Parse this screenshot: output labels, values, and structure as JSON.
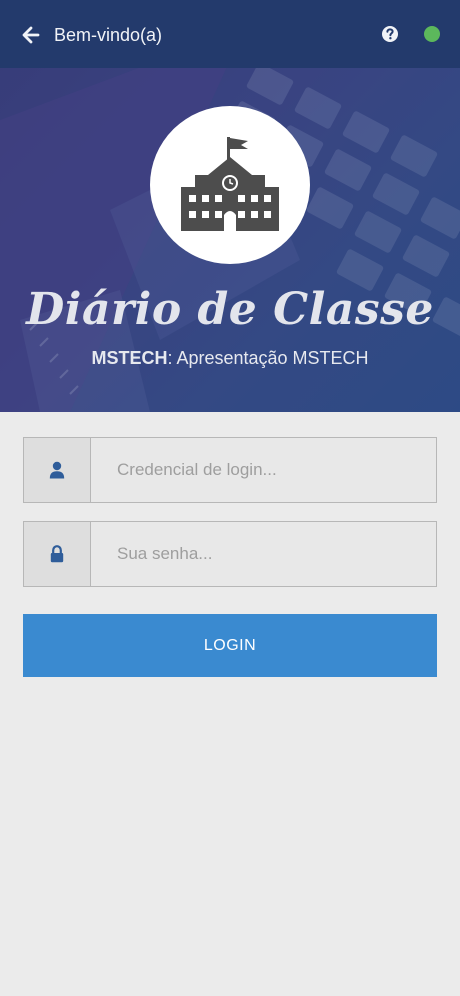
{
  "header": {
    "title": "Bem-vindo(a)",
    "status_color": "#5cb85c",
    "icons": {
      "back": "arrow-left-icon",
      "help": "question-circle-icon"
    }
  },
  "banner": {
    "logo_icon": "school-building-icon",
    "app_title": "Diário de Classe",
    "org_name": "MSTECH",
    "org_separator": ": ",
    "org_description": "Apresentação MSTECH"
  },
  "login_form": {
    "username": {
      "placeholder": "Credencial de login...",
      "value": "",
      "icon": "user-icon"
    },
    "password": {
      "placeholder": "Sua senha...",
      "value": "",
      "icon": "lock-icon"
    },
    "submit_label": "LOGIN"
  },
  "colors": {
    "header_bg": "#233a6c",
    "accent": "#3a8ad0",
    "icon_blue": "#2f5d9a"
  }
}
